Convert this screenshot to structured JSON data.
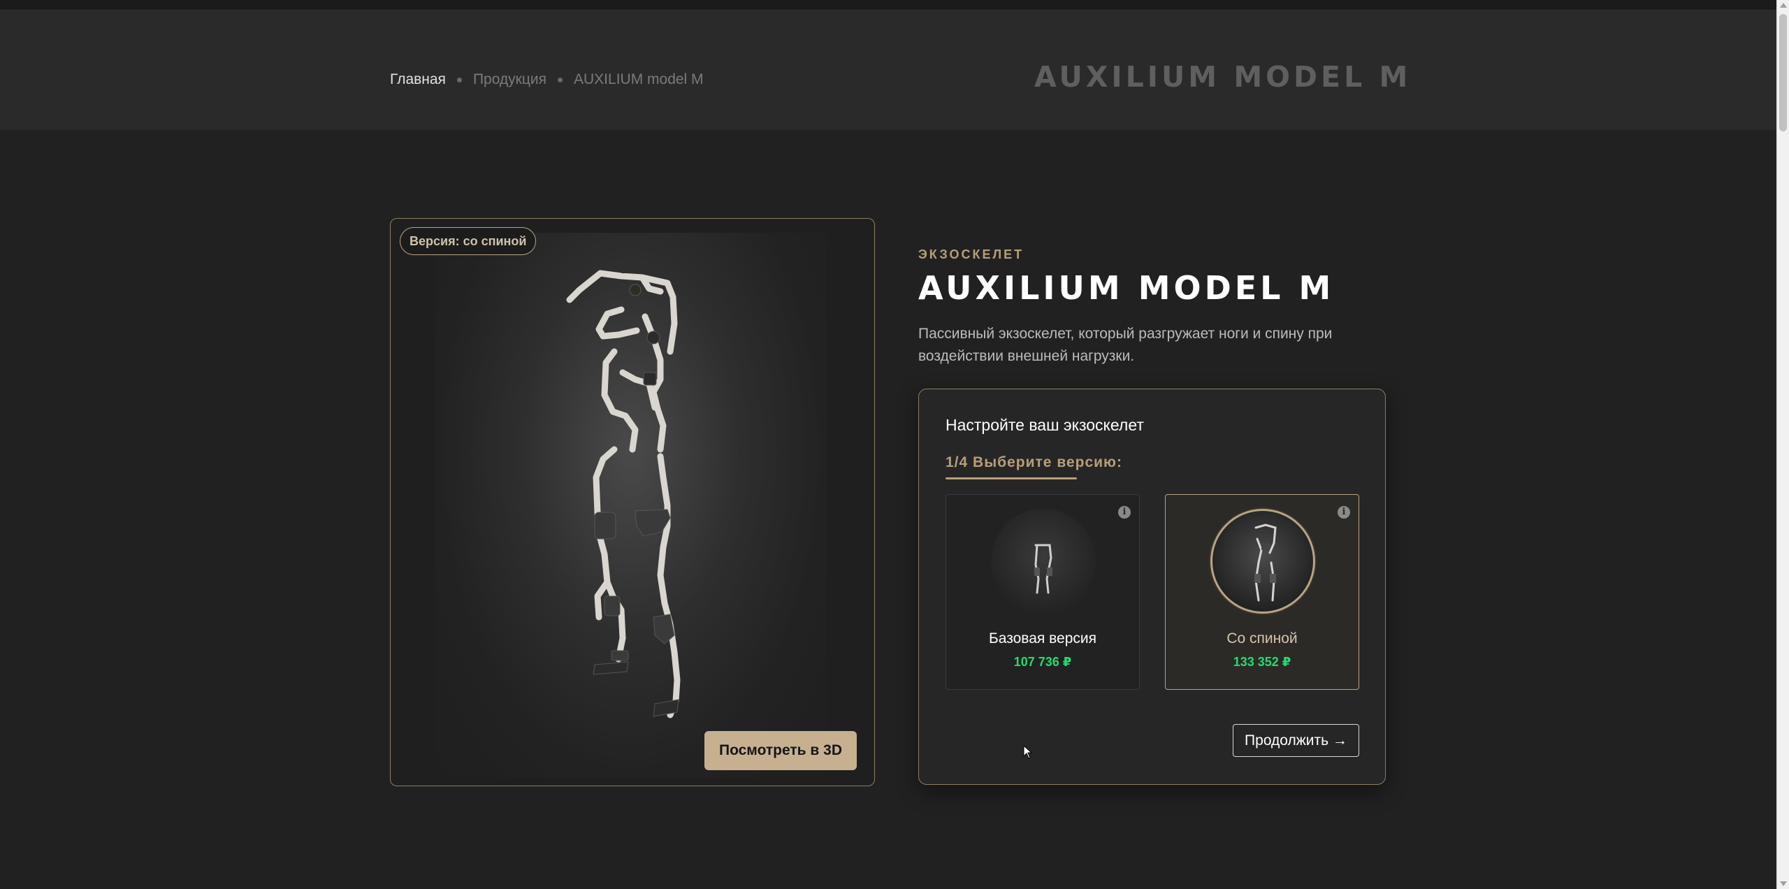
{
  "breadcrumb": {
    "home": "Главная",
    "products": "Продукция",
    "current": "AUXILIUM model M"
  },
  "header": {
    "brand": "AUXILIUM MODEL M"
  },
  "image_card": {
    "version_badge": "Версия: со спиной",
    "view_3d_label": "Посмотреть в 3D"
  },
  "product": {
    "eyebrow": "ЭКЗОСКЕЛЕТ",
    "title": "AUXILIUM MODEL M",
    "description": "Пассивный экзоскелет, который разгружает ноги и спину при воздействии внешней нагрузки."
  },
  "configurator": {
    "title": "Настройте ваш экзоскелет",
    "step": "1/4 Выберите версию:",
    "options": [
      {
        "label": "Базовая версия",
        "price": "107 736 ₽",
        "selected": false
      },
      {
        "label": "Со спиной",
        "price": "133 352 ₽",
        "selected": true
      }
    ],
    "continue_label": "Продолжить →"
  },
  "colors": {
    "accent_gold": "#b89f7a",
    "price_green": "#1fde6e",
    "background": "#212121"
  }
}
